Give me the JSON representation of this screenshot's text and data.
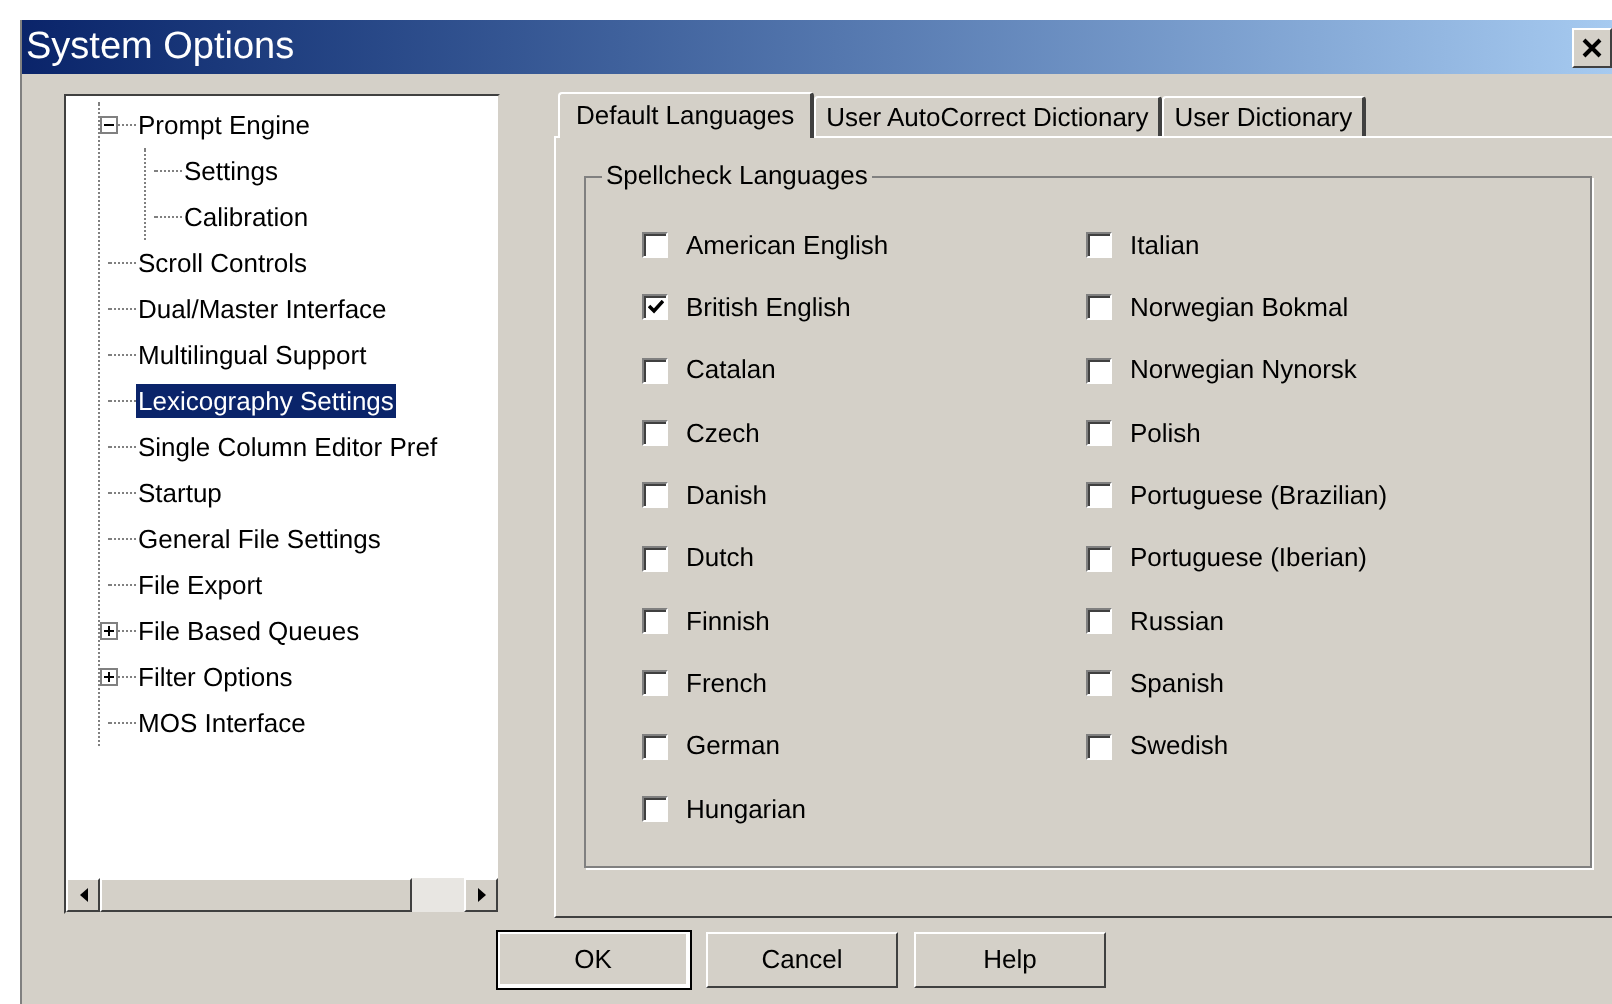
{
  "window": {
    "title": "System Options"
  },
  "tree": [
    {
      "label": "Prompt Engine",
      "expanded": true,
      "selected": false,
      "children": [
        {
          "label": "Settings",
          "selected": false
        },
        {
          "label": "Calibration",
          "selected": false
        }
      ]
    },
    {
      "label": "Scroll Controls",
      "selected": false
    },
    {
      "label": "Dual/Master Interface",
      "selected": false
    },
    {
      "label": "Multilingual Support",
      "selected": false
    },
    {
      "label": "Lexicography Settings",
      "selected": true
    },
    {
      "label": "Single Column Editor Pref",
      "selected": false
    },
    {
      "label": "Startup",
      "selected": false
    },
    {
      "label": "General File Settings",
      "selected": false
    },
    {
      "label": "File Export",
      "selected": false
    },
    {
      "label": "File Based Queues",
      "expanded": false,
      "selected": false
    },
    {
      "label": "Filter Options",
      "expanded": false,
      "selected": false
    },
    {
      "label": "MOS Interface",
      "selected": false
    }
  ],
  "tabs": [
    {
      "label": "Default Languages",
      "selected": true
    },
    {
      "label": "User AutoCorrect Dictionary",
      "selected": false
    },
    {
      "label": "User Dictionary",
      "selected": false
    }
  ],
  "group": {
    "title": "Spellcheck Languages",
    "columns": [
      [
        {
          "label": "American English",
          "checked": false
        },
        {
          "label": "British English",
          "checked": true
        },
        {
          "label": "Catalan",
          "checked": false
        },
        {
          "label": "Czech",
          "checked": false
        },
        {
          "label": "Danish",
          "checked": false
        },
        {
          "label": "Dutch",
          "checked": false
        },
        {
          "label": "Finnish",
          "checked": false
        },
        {
          "label": "French",
          "checked": false
        },
        {
          "label": "German",
          "checked": false
        },
        {
          "label": "Hungarian",
          "checked": false
        }
      ],
      [
        {
          "label": "Italian",
          "checked": false
        },
        {
          "label": "Norwegian Bokmal",
          "checked": false
        },
        {
          "label": "Norwegian Nynorsk",
          "checked": false
        },
        {
          "label": "Polish",
          "checked": false
        },
        {
          "label": "Portuguese (Brazilian)",
          "checked": false
        },
        {
          "label": "Portuguese (Iberian)",
          "checked": false
        },
        {
          "label": "Russian",
          "checked": false
        },
        {
          "label": "Spanish",
          "checked": false
        },
        {
          "label": "Swedish",
          "checked": false
        }
      ]
    ]
  },
  "buttons": [
    {
      "label": "OK",
      "default": true
    },
    {
      "label": "Cancel",
      "default": false
    },
    {
      "label": "Help",
      "default": false
    }
  ]
}
